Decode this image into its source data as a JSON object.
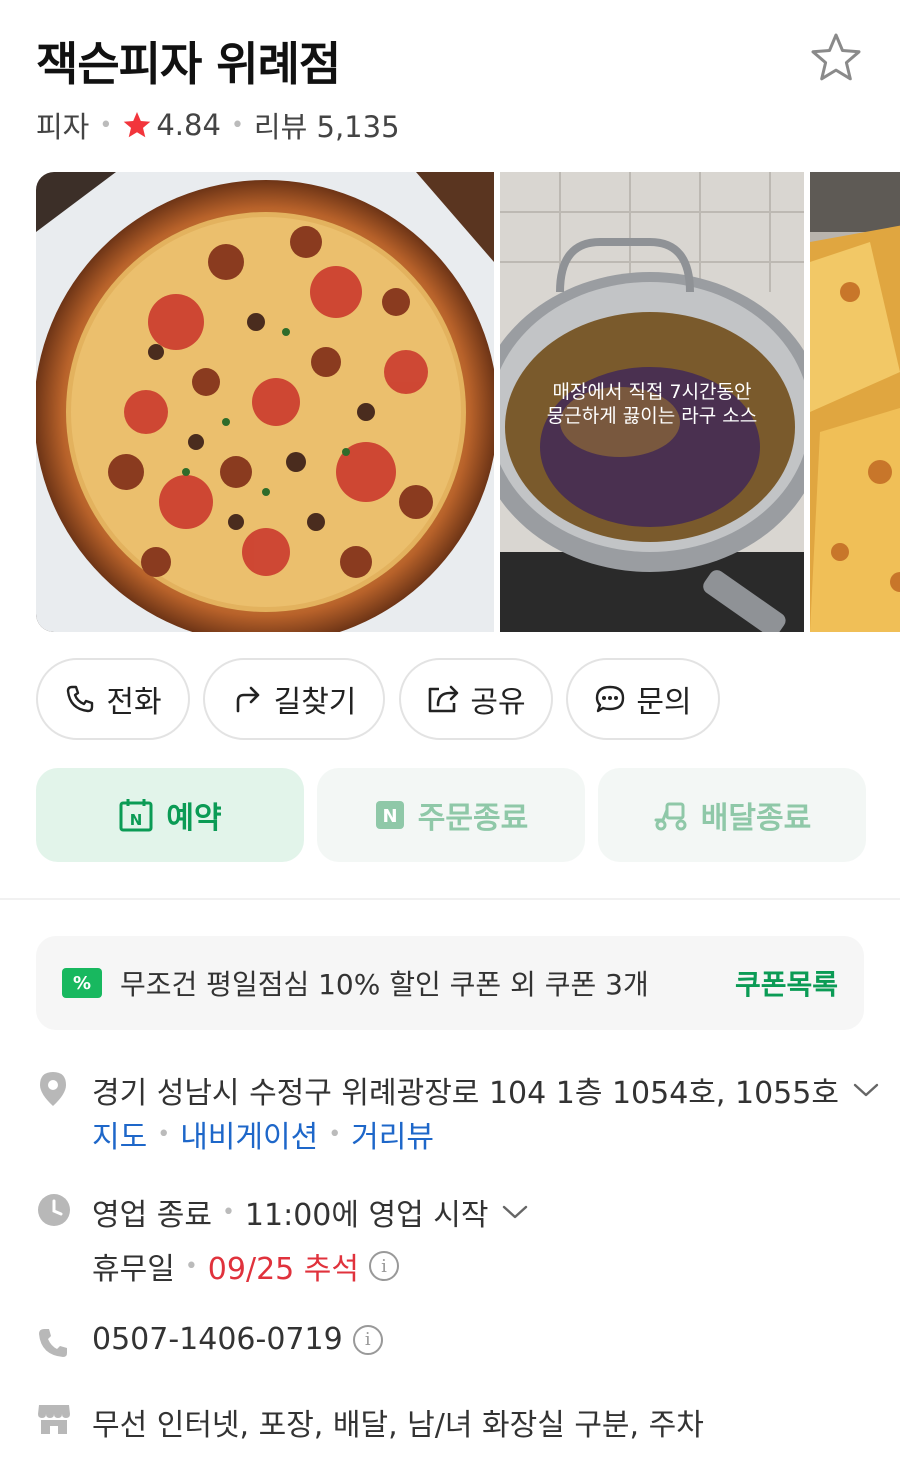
{
  "place": {
    "name": "잭슨피자 위례점",
    "category": "피자",
    "rating": "4.84",
    "reviews": "리뷰 5,135"
  },
  "gallery": {
    "photo2_caption_line1": "매장에서 직접 7시간동안",
    "photo2_caption_line2": "뭉근하게 끓이는 라구 소스"
  },
  "actions": {
    "call": "전화",
    "directions": "길찾기",
    "share": "공유",
    "inquiry": "문의"
  },
  "services": {
    "reserve": "예약",
    "order": "주문종료",
    "delivery": "배달종료"
  },
  "coupon": {
    "badge": "%",
    "text": "무조건 평일점심 10% 할인 쿠폰 외 쿠폰 3개",
    "link": "쿠폰목록"
  },
  "address": {
    "text": "경기 성남시 수정구 위례광장로 104 1층 1054호, 1055호",
    "map": "지도",
    "navigation": "내비게이션",
    "streetview": "거리뷰"
  },
  "hours": {
    "status": "영업 종료",
    "next": "11:00에 영업 시작",
    "holiday_label": "휴무일",
    "holiday_value": "09/25 추석"
  },
  "phone": "0507-1406-0719",
  "amenities": "무선 인터넷, 포장, 배달, 남/녀 화장실 구분, 주차",
  "colors": {
    "accent_green": "#0b9b55",
    "link_blue": "#1e67c9",
    "holiday_red": "#e0323c",
    "star_red": "#f2353c"
  }
}
